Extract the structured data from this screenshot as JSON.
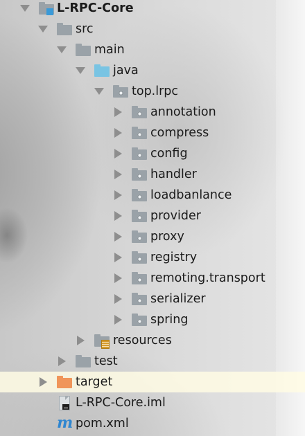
{
  "project_tree": {
    "root": {
      "label": "L-RPC-Core",
      "icon": "module-folder-icon",
      "state": "expanded"
    },
    "src": {
      "label": "src",
      "icon": "folder-icon",
      "state": "expanded"
    },
    "main": {
      "label": "main",
      "icon": "folder-icon",
      "state": "expanded"
    },
    "java": {
      "label": "java",
      "icon": "source-root-folder-icon",
      "state": "expanded"
    },
    "package": {
      "label": "top.lrpc",
      "icon": "package-icon",
      "state": "expanded"
    },
    "packages": [
      {
        "label": "annotation",
        "icon": "package-icon",
        "state": "collapsed"
      },
      {
        "label": "compress",
        "icon": "package-icon",
        "state": "collapsed"
      },
      {
        "label": "config",
        "icon": "package-icon",
        "state": "collapsed"
      },
      {
        "label": "handler",
        "icon": "package-icon",
        "state": "collapsed"
      },
      {
        "label": "loadbanlance",
        "icon": "package-icon",
        "state": "collapsed"
      },
      {
        "label": "provider",
        "icon": "package-icon",
        "state": "collapsed"
      },
      {
        "label": "proxy",
        "icon": "package-icon",
        "state": "collapsed"
      },
      {
        "label": "registry",
        "icon": "package-icon",
        "state": "collapsed"
      },
      {
        "label": "remoting.transport",
        "icon": "package-icon",
        "state": "collapsed"
      },
      {
        "label": "serializer",
        "icon": "package-icon",
        "state": "collapsed"
      },
      {
        "label": "spring",
        "icon": "package-icon",
        "state": "collapsed"
      }
    ],
    "resources": {
      "label": "resources",
      "icon": "resources-folder-icon",
      "state": "collapsed"
    },
    "test": {
      "label": "test",
      "icon": "folder-icon",
      "state": "collapsed"
    },
    "target": {
      "label": "target",
      "icon": "excluded-folder-icon",
      "state": "collapsed",
      "highlighted": true
    },
    "iml_file": {
      "label": "L-RPC-Core.iml",
      "icon": "iml-file-icon"
    },
    "pom_file": {
      "label": "pom.xml",
      "icon": "maven-icon"
    }
  },
  "colors": {
    "folder": "#9aa2a8",
    "source_root": "#79c4e3",
    "excluded": "#f0955a",
    "module_marker": "#3a9ad8",
    "maven": "#2f86d0",
    "highlight_row": "#fffce4"
  }
}
